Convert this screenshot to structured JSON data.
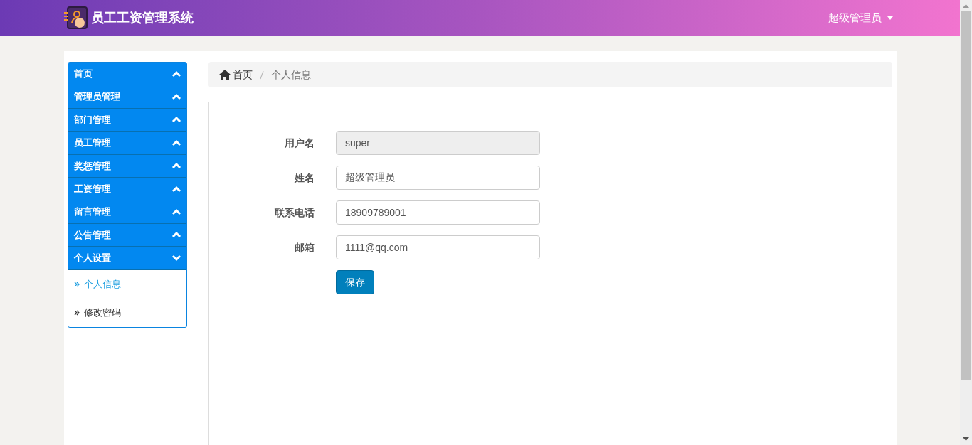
{
  "header": {
    "title": "员工工资管理系统",
    "user": "超级管理员"
  },
  "sidebar": {
    "items": [
      {
        "label": "首页",
        "expanded": false
      },
      {
        "label": "管理员管理",
        "expanded": false
      },
      {
        "label": "部门管理",
        "expanded": false
      },
      {
        "label": "员工管理",
        "expanded": false
      },
      {
        "label": "奖惩管理",
        "expanded": false
      },
      {
        "label": "工资管理",
        "expanded": false
      },
      {
        "label": "留言管理",
        "expanded": false
      },
      {
        "label": "公告管理",
        "expanded": false
      },
      {
        "label": "个人设置",
        "expanded": true,
        "children": [
          {
            "label": "个人信息",
            "selected": true
          },
          {
            "label": "修改密码",
            "selected": false
          }
        ]
      }
    ]
  },
  "breadcrumb": [
    {
      "label": "首页"
    },
    {
      "label": "个人信息"
    }
  ],
  "form": {
    "fields": [
      {
        "label": "用户名",
        "value": "super",
        "disabled": true
      },
      {
        "label": "姓名",
        "value": "超级管理员",
        "disabled": false
      },
      {
        "label": "联系电话",
        "value": "18909789001",
        "disabled": false
      },
      {
        "label": "邮箱",
        "value": "1111@qq.com",
        "disabled": false
      }
    ],
    "submit": "保存"
  }
}
